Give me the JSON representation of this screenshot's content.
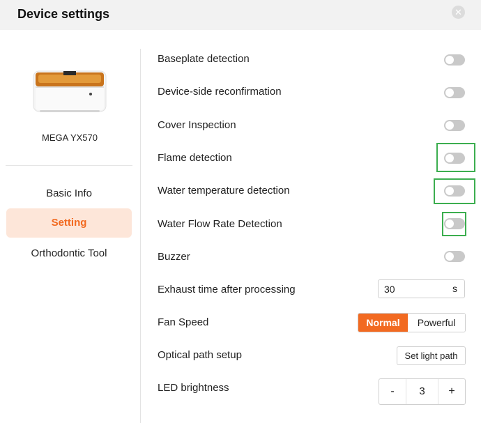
{
  "dialog": {
    "title": "Device settings",
    "close_icon": "close-icon"
  },
  "sidebar": {
    "device_name": "MEGA YX570",
    "nav": [
      {
        "label": "Basic Info",
        "active": false
      },
      {
        "label": "Setting",
        "active": true
      },
      {
        "label": "Orthodontic Tool",
        "active": false
      }
    ]
  },
  "settings": {
    "toggles": [
      {
        "label": "Baseplate detection",
        "on": false
      },
      {
        "label": "Device-side reconfirmation",
        "on": false
      },
      {
        "label": "Cover Inspection",
        "on": false
      },
      {
        "label": "Flame detection",
        "on": false
      },
      {
        "label": "Water temperature detection",
        "on": false
      },
      {
        "label": "Water Flow Rate Detection",
        "on": false
      },
      {
        "label": "Buzzer",
        "on": false
      }
    ],
    "exhaust": {
      "label": "Exhaust time after processing",
      "value": "30",
      "unit": "s"
    },
    "fan": {
      "label": "Fan Speed",
      "options": [
        "Normal",
        "Powerful"
      ],
      "selected": "Normal"
    },
    "optical": {
      "label": "Optical path setup",
      "button": "Set light path"
    },
    "led": {
      "label": "LED brightness",
      "minus": "-",
      "value": "3",
      "plus": "+"
    }
  },
  "colors": {
    "accent": "#f26a21",
    "accent_bg": "#fde6d9",
    "highlight": "#3cae4f",
    "toggle_off": "#c9c9c9"
  }
}
